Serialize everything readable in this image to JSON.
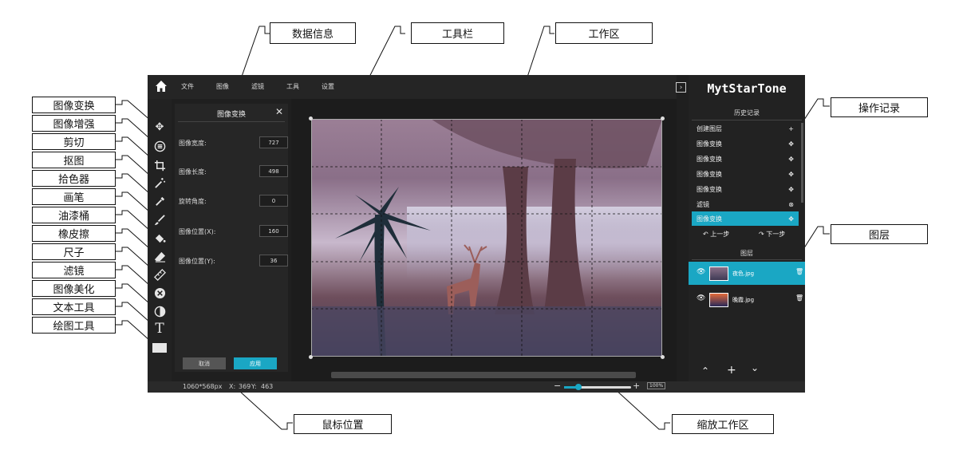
{
  "annotations": {
    "left": [
      "图像变换",
      "图像增强",
      "剪切",
      "抠图",
      "拾色器",
      "画笔",
      "油漆桶",
      "橡皮擦",
      "尺子",
      "滤镜",
      "图像美化",
      "文本工具",
      "绘图工具"
    ],
    "data_info": "数据信息",
    "toolbar": "工具栏",
    "workspace": "工作区",
    "operation_log": "操作记录",
    "layers": "图层",
    "mouse_position": "鼠标位置",
    "zoom_workspace": "缩放工作区"
  },
  "menubar": {
    "items": [
      "文件",
      "图像",
      "滤镜",
      "工具",
      "设置"
    ]
  },
  "brand": "MytStarTone",
  "props_panel": {
    "title": "图像变换",
    "fields": [
      {
        "label": "图像宽度:",
        "value": "727"
      },
      {
        "label": "图像长度:",
        "value": "498"
      },
      {
        "label": "旋转角度:",
        "value": "0"
      },
      {
        "label": "图像位置(X):",
        "value": "160"
      },
      {
        "label": "图像位置(Y):",
        "value": "36"
      }
    ],
    "cancel": "取消",
    "apply": "应用"
  },
  "history": {
    "title": "历史记录",
    "items": [
      {
        "label": "创建图层",
        "icon": "+"
      },
      {
        "label": "图像变换",
        "icon": "✥"
      },
      {
        "label": "图像变换",
        "icon": "✥"
      },
      {
        "label": "图像变换",
        "icon": "✥"
      },
      {
        "label": "图像变换",
        "icon": "✥"
      },
      {
        "label": "滤镜",
        "icon": "⊗"
      },
      {
        "label": "图像变换",
        "icon": "✥",
        "active": true
      }
    ],
    "undo": "上一步",
    "redo": "下一步"
  },
  "layers": {
    "title": "图层",
    "items": [
      {
        "name": "夜色.jpg",
        "active": true
      },
      {
        "name": "晚霞.jpg",
        "active": false
      }
    ]
  },
  "status": {
    "dimensions": "1060*568px",
    "x_label": "X:",
    "x": "369",
    "y_label": "Y:",
    "y": "463",
    "zoom": "100%"
  },
  "colors": {
    "accent": "#1aa7c4",
    "bg": "#1f1f1f"
  }
}
